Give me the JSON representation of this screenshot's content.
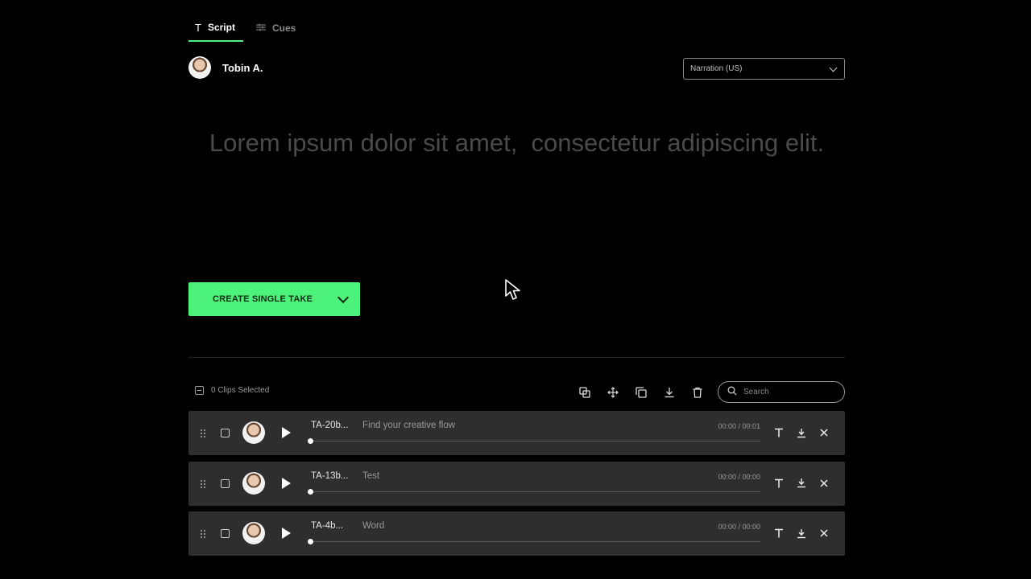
{
  "tabs": [
    {
      "label": "Script",
      "icon": "text-icon",
      "active": true
    },
    {
      "label": "Cues",
      "icon": "sliders-icon",
      "active": false
    }
  ],
  "voice": {
    "name": "Tobin A."
  },
  "language_select": {
    "value": "Narration (US)"
  },
  "script": {
    "text": "Lorem ipsum dolor sit amet,  consectetur adipiscing elit."
  },
  "create_button": {
    "label": "CREATE SINGLE TAKE"
  },
  "toolbar": {
    "selected_label": "0 Clips Selected",
    "icons": [
      "combine-icon",
      "move-icon",
      "duplicate-icon",
      "download-icon",
      "trash-icon"
    ],
    "search_placeholder": "Search"
  },
  "clips": [
    {
      "id": "TA-20b...",
      "text": "Find your creative flow",
      "time": "00:00 / 00:01",
      "progress": 0
    },
    {
      "id": "TA-13b...",
      "text": "Test",
      "time": "00:00 / 00:00",
      "progress": 0
    },
    {
      "id": "TA-4b...",
      "text": "Word",
      "time": "00:00 / 00:00",
      "progress": 0
    }
  ],
  "colors": {
    "accent": "#4cf27a",
    "background": "#000000",
    "row": "#2e2e2e"
  }
}
